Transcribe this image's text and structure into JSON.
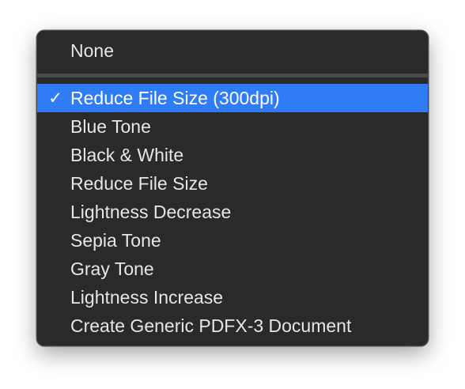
{
  "menu": {
    "none_item": {
      "label": "None"
    },
    "items": [
      {
        "label": "Reduce File Size (300dpi)",
        "checked": true,
        "check_glyph": "✓"
      },
      {
        "label": "Blue Tone",
        "checked": false
      },
      {
        "label": "Black & White",
        "checked": false
      },
      {
        "label": "Reduce File Size",
        "checked": false
      },
      {
        "label": "Lightness Decrease",
        "checked": false
      },
      {
        "label": "Sepia Tone",
        "checked": false
      },
      {
        "label": "Gray Tone",
        "checked": false
      },
      {
        "label": "Lightness Increase",
        "checked": false
      },
      {
        "label": "Create Generic PDFX-3 Document",
        "checked": false
      }
    ]
  },
  "colors": {
    "menu_background": "#2a2a2a",
    "highlight": "#2f7cf6",
    "text": "#e6e6e6",
    "separator": "#4a4a4a"
  }
}
